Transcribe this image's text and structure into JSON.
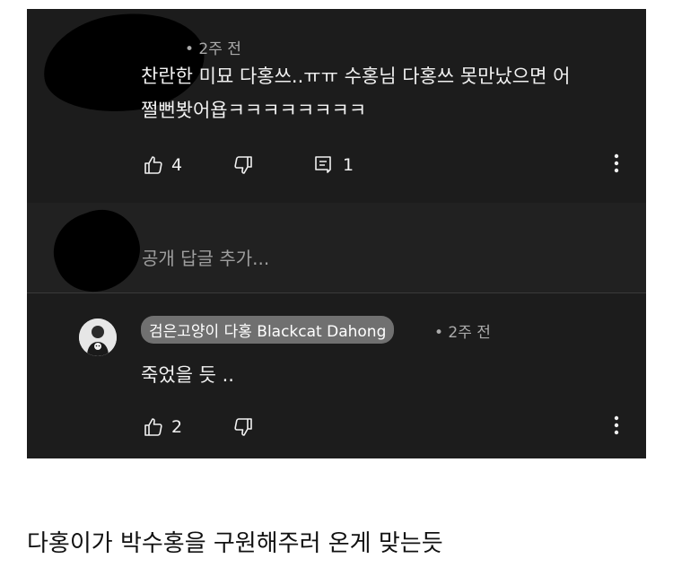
{
  "comment": {
    "time": "• 2주 전",
    "text_line1": "찬란한 미묘 다홍쓰..ㅠㅠ 수홍님 다홍쓰 못만났으면 어",
    "text_line2": "쩔뻔봣어욥ㅋㅋㅋㅋㅋㅋㅋㅋ",
    "likes": "4",
    "replies": "1"
  },
  "reply_box": {
    "placeholder": "공개 답글 추가..."
  },
  "reply": {
    "author": "검은고양이 다홍 Blackcat Dahong",
    "time": "• 2주 전",
    "text": "죽었을 듯 ..",
    "likes": "2"
  },
  "caption": "다홍이가 박수홍을 구원해주러 온게 맞는듯",
  "colors": {
    "background": "#1c1c1c",
    "text": "#f1f1f1",
    "meta": "#aaaaaa",
    "chip": "#707070"
  }
}
